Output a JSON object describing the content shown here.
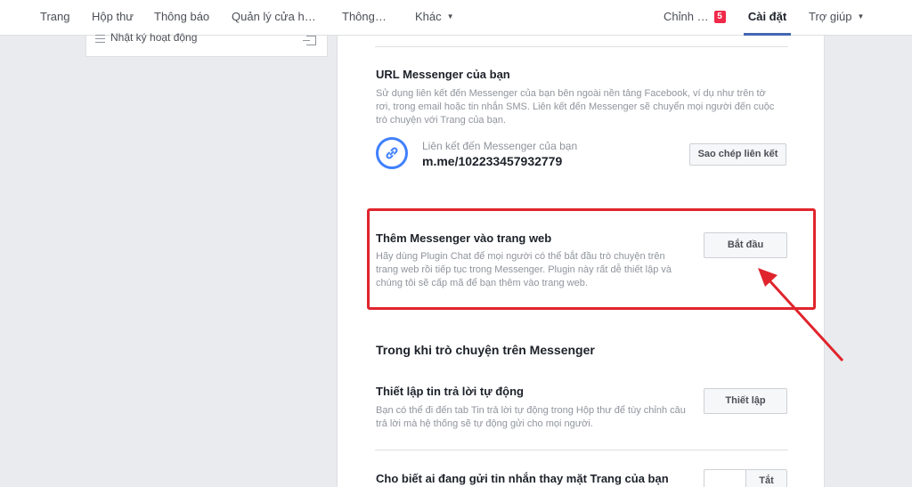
{
  "nav": {
    "items": [
      "Trang",
      "Hộp thư",
      "Thông báo",
      "Quản lý cửa h…",
      "Thông…",
      "Khác"
    ],
    "right": {
      "edit_label": "Chỉnh …",
      "edit_badge": "5",
      "settings_label": "Cài đặt",
      "help_label": "Trợ giúp"
    }
  },
  "sidebar": {
    "item_label": "Nhật ký hoạt động"
  },
  "url_section": {
    "title": "URL Messenger của bạn",
    "description": "Sử dụng liên kết đến Messenger của bạn bên ngoài nền tảng Facebook, ví dụ như trên tờ rơi, trong email hoặc tin nhắn SMS. Liên kết đến Messenger sẽ chuyển mọi người đến cuộc trò chuyện với Trang của bạn.",
    "link_caption": "Liên kết đến Messenger của bạn",
    "link_value": "m.me/102233457932779",
    "copy_button": "Sao chép liên kết"
  },
  "web_section": {
    "title": "Thêm Messenger vào trang web",
    "description": "Hãy dùng Plugin Chat để mọi người có thể bắt đầu trò chuyện trên trang web rồi tiếp tục trong Messenger. Plugin này rất dễ thiết lập và chúng tôi sẽ cấp mã để bạn thêm vào trang web.",
    "start_button": "Bắt đầu"
  },
  "chat_heading": "Trong khi trò chuyện trên Messenger",
  "auto_reply": {
    "title": "Thiết lập tin trả lời tự động",
    "description": "Bạn có thể đi đến tab Tin trả lời tự động trong Hộp thư để tùy chỉnh câu trả lời mà hệ thống sẽ tự động gửi cho mọi người.",
    "setup_button": "Thiết lập"
  },
  "sender": {
    "title": "Cho biết ai đang gửi tin nhắn thay mặt Trang của bạn",
    "toggle_label": "Tắt"
  },
  "colors": {
    "accent": "#4267b2",
    "link_icon": "#4080ff",
    "annotation": "#e0242d",
    "badge": "#f02849"
  },
  "icons": [
    "list-icon",
    "exit-icon",
    "link-icon",
    "caret-down-icon",
    "arrow-annotation"
  ]
}
